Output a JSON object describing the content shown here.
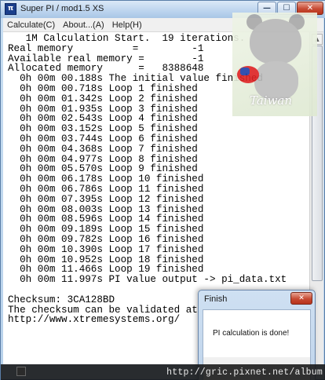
{
  "window": {
    "title": "Super PI / mod1.5 XS",
    "app_icon": "pi-icon",
    "minimize_glyph": "—",
    "maximize_glyph": "☐",
    "close_glyph": "✕"
  },
  "menu": {
    "items": [
      {
        "label": "Calculate(C)"
      },
      {
        "label": "About...(A)"
      },
      {
        "label": "Help(H)"
      }
    ]
  },
  "console": {
    "lines": [
      "   1M Calculation Start.  19 iterations.",
      "Real memory          =         -1",
      "Available real memory =        -1",
      "Allocated memory      =   8388648",
      "  0h 00m 00.188s The initial value finished",
      "  0h 00m 00.718s Loop 1 finished",
      "  0h 00m 01.342s Loop 2 finished",
      "  0h 00m 01.935s Loop 3 finished",
      "  0h 00m 02.543s Loop 4 finished",
      "  0h 00m 03.152s Loop 5 finished",
      "  0h 00m 03.744s Loop 6 finished",
      "  0h 00m 04.368s Loop 7 finished",
      "  0h 00m 04.977s Loop 8 finished",
      "  0h 00m 05.570s Loop 9 finished",
      "  0h 00m 06.178s Loop 10 finished",
      "  0h 00m 06.786s Loop 11 finished",
      "  0h 00m 07.395s Loop 12 finished",
      "  0h 00m 08.003s Loop 13 finished",
      "  0h 00m 08.596s Loop 14 finished",
      "  0h 00m 09.189s Loop 15 finished",
      "  0h 00m 09.782s Loop 16 finished",
      "  0h 00m 10.390s Loop 17 finished",
      "  0h 00m 10.952s Loop 18 finished",
      "  0h 00m 11.466s Loop 19 finished",
      "  0h 00m 11.997s PI value output -> pi_data.txt",
      "",
      "Checksum: 3CA128BD",
      "The checksum can be validated at",
      "http://www.xtremesystems.org/"
    ]
  },
  "watermark": {
    "mascot_label": "Taiwan",
    "url": "http://gric.pixnet.net/album"
  },
  "dialog": {
    "title": "Finish",
    "close_glyph": "✕",
    "message": "PI calculation is done!"
  },
  "colors": {
    "close_red": "#c74a33",
    "titlebar_blue": "#bcd4ee"
  }
}
